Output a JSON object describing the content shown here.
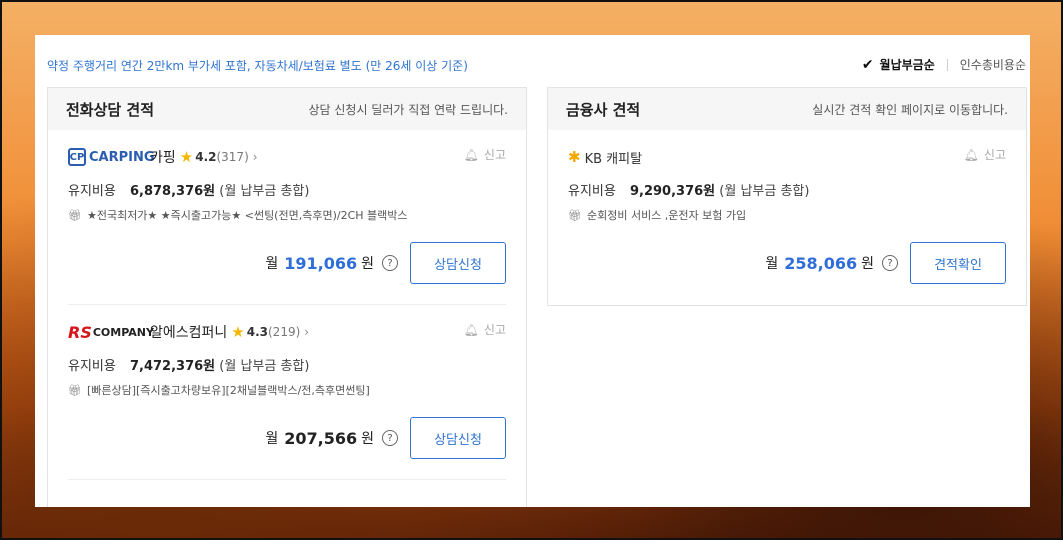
{
  "topnote": "약정 주행거리 연간 2만km 부가세 포함, 자동차세/보험료 별도 (만 26세 이상 기준)",
  "sort": {
    "active": "월납부금순",
    "inactive": "인수총비용순"
  },
  "phone_card": {
    "title": "전화상담 견적",
    "subtitle": "상담 신청시 딜러가 직접 연락 드립니다.",
    "dealers": [
      {
        "logo": "CARPING",
        "name": "카핑",
        "rating": "4.2",
        "reviews": "(317)",
        "report": "신고",
        "cost_label": "유지비용",
        "cost_amount": "6,878,376원",
        "cost_note": "(월 납부금 총합)",
        "perks": "★전국최저가★ ★즉시출고가능★ <썬팅(전면,측후면)/2CH 블랙박스",
        "monthly_prefix": "월",
        "monthly_value": "191,066",
        "monthly_suffix": "원",
        "button": "상담신청"
      },
      {
        "logo": "COMPANY",
        "name": "알에스컴퍼니",
        "rating": "4.3",
        "reviews": "(219)",
        "report": "신고",
        "cost_label": "유지비용",
        "cost_amount": "7,472,376원",
        "cost_note": "(월 납부금 총합)",
        "perks": "[빠른상담][즉시출고차량보유][2채널블랙박스/전,측후면썬팅]",
        "monthly_prefix": "월",
        "monthly_value": "207,566",
        "monthly_suffix": "원",
        "button": "상담신청"
      }
    ]
  },
  "finance_card": {
    "title": "금융사 견적",
    "subtitle": "실시간 견적 확인 페이지로 이동합니다.",
    "dealer": {
      "logo": "KB 캐피탈",
      "report": "신고",
      "cost_label": "유지비용",
      "cost_amount": "9,290,376원",
      "cost_note": "(월 납부금 총합)",
      "perks": "순회정비 서비스 ,운전자 보험 가입",
      "monthly_prefix": "월",
      "monthly_value": "258,066",
      "monthly_suffix": "원",
      "button": "견적확인"
    }
  },
  "colors": {
    "accent": "#2f74d0",
    "star": "#f5b800"
  }
}
